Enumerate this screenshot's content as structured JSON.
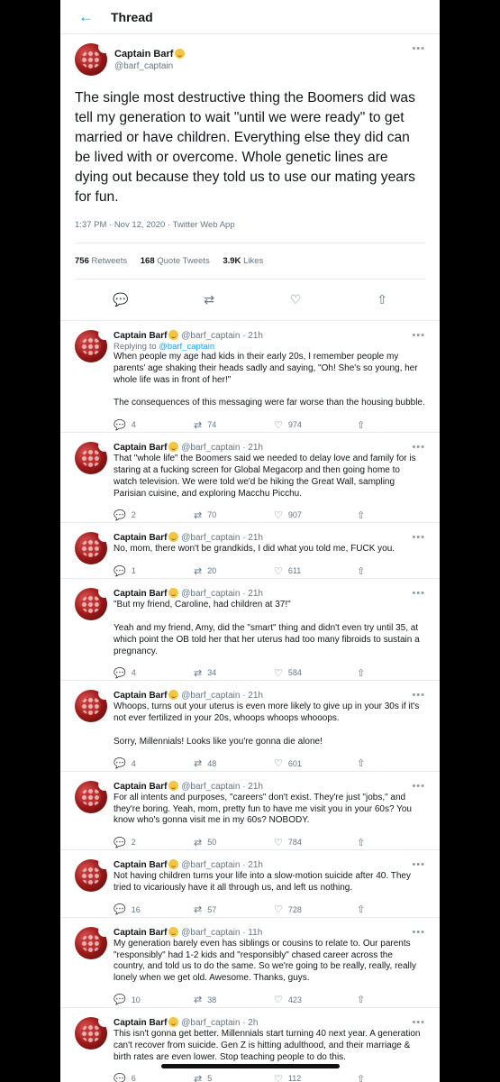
{
  "header": {
    "back_icon": "arrow-left-icon",
    "title": "Thread"
  },
  "main_tweet": {
    "name": "Captain Barf",
    "handle": "@barf_captain",
    "text": "The single most destructive thing the Boomers did was tell my generation to wait  \"until we were ready\" to get married or have children. Everything else they did can be lived with or overcome. Whole genetic lines are dying out because they told us to use our mating years for fun.",
    "meta": "1:37 PM · Nov 12, 2020 · Twitter Web App",
    "retweets": "756",
    "retweets_label": "Retweets",
    "quotes": "168",
    "quotes_label": "Quote Tweets",
    "likes": "3.9K",
    "likes_label": "Likes"
  },
  "replies": [
    {
      "name": "Captain Barf",
      "handle": "@barf_captain · 21h",
      "replying_prefix": "Replying to ",
      "replying_to": "@barf_captain",
      "paragraphs": [
        "When people my age had kids in their early 20s, I remember people my parents' age shaking their heads sadly and saying, \"Oh! She's so young, her whole life was in front of her!\"",
        "The consequences of this messaging were far worse than the housing bubble."
      ],
      "replies": "4",
      "retweets": "74",
      "likes": "974"
    },
    {
      "name": "Captain Barf",
      "handle": "@barf_captain · 21h",
      "paragraphs": [
        "That \"whole life\" the Boomers said we needed to delay love and family for is staring at a fucking screen for Global Megacorp and then going home to watch television. We were told we'd be hiking the Great Wall, sampling Parisian cuisine, and exploring Macchu Picchu."
      ],
      "replies": "2",
      "retweets": "70",
      "likes": "907"
    },
    {
      "name": "Captain Barf",
      "handle": "@barf_captain · 21h",
      "paragraphs": [
        "No, mom, there won't be grandkids, I did what you told me, FUCK you."
      ],
      "replies": "1",
      "retweets": "20",
      "likes": "611"
    },
    {
      "name": "Captain Barf",
      "handle": "@barf_captain · 21h",
      "paragraphs": [
        "\"But my friend, Caroline, had children at 37!\"",
        "Yeah and my friend, Amy, did the \"smart\" thing and didn't even try until 35, at which point the OB told her that her uterus had too many fibroids to sustain a pregnancy."
      ],
      "replies": "4",
      "retweets": "34",
      "likes": "584"
    },
    {
      "name": "Captain Barf",
      "handle": "@barf_captain · 21h",
      "paragraphs": [
        "Whoops, turns out your uterus is even more likely to give up  in your 30s if it's not ever fertilized in your 20s, whoops whoops whooops.",
        "Sorry, Millennials! Looks like you're gonna die alone!"
      ],
      "replies": "4",
      "retweets": "48",
      "likes": "601"
    },
    {
      "name": "Captain Barf",
      "handle": "@barf_captain · 21h",
      "paragraphs": [
        "For all intents and purposes, \"careers\" don't exist. They're just \"jobs,\" and they're boring. Yeah, mom, pretty fun to have me visit you in your 60s? You know who's gonna visit me in my 60s? NOBODY."
      ],
      "replies": "2",
      "retweets": "50",
      "likes": "784"
    },
    {
      "name": "Captain Barf",
      "handle": "@barf_captain · 21h",
      "paragraphs": [
        "Not having children turns your life into a slow-motion suicide after 40. They tried to vicariously have it all through us, and left us nothing."
      ],
      "replies": "16",
      "retweets": "57",
      "likes": "728"
    },
    {
      "name": "Captain Barf",
      "handle": "@barf_captain · 11h",
      "paragraphs": [
        "My generation barely even has siblings or cousins to relate to. Our parents \"responsibly\" had 1-2 kids and \"responsibly\" chased career across the country, and told us to do the same. So we're going to be really, really, really lonely when we get old. Awesome. Thanks, guys."
      ],
      "replies": "10",
      "retweets": "38",
      "likes": "423"
    },
    {
      "name": "Captain Barf",
      "handle": "@barf_captain · 2h",
      "paragraphs": [
        "This isn't gonna get better. Millennials start turning 40 next year. A generation can't recover from suicide. Gen Z is hitting adulthood, and their marriage & birth rates are even lower. Stop teaching people to do this."
      ],
      "replies": "6",
      "retweets": "5",
      "likes": "112"
    }
  ]
}
